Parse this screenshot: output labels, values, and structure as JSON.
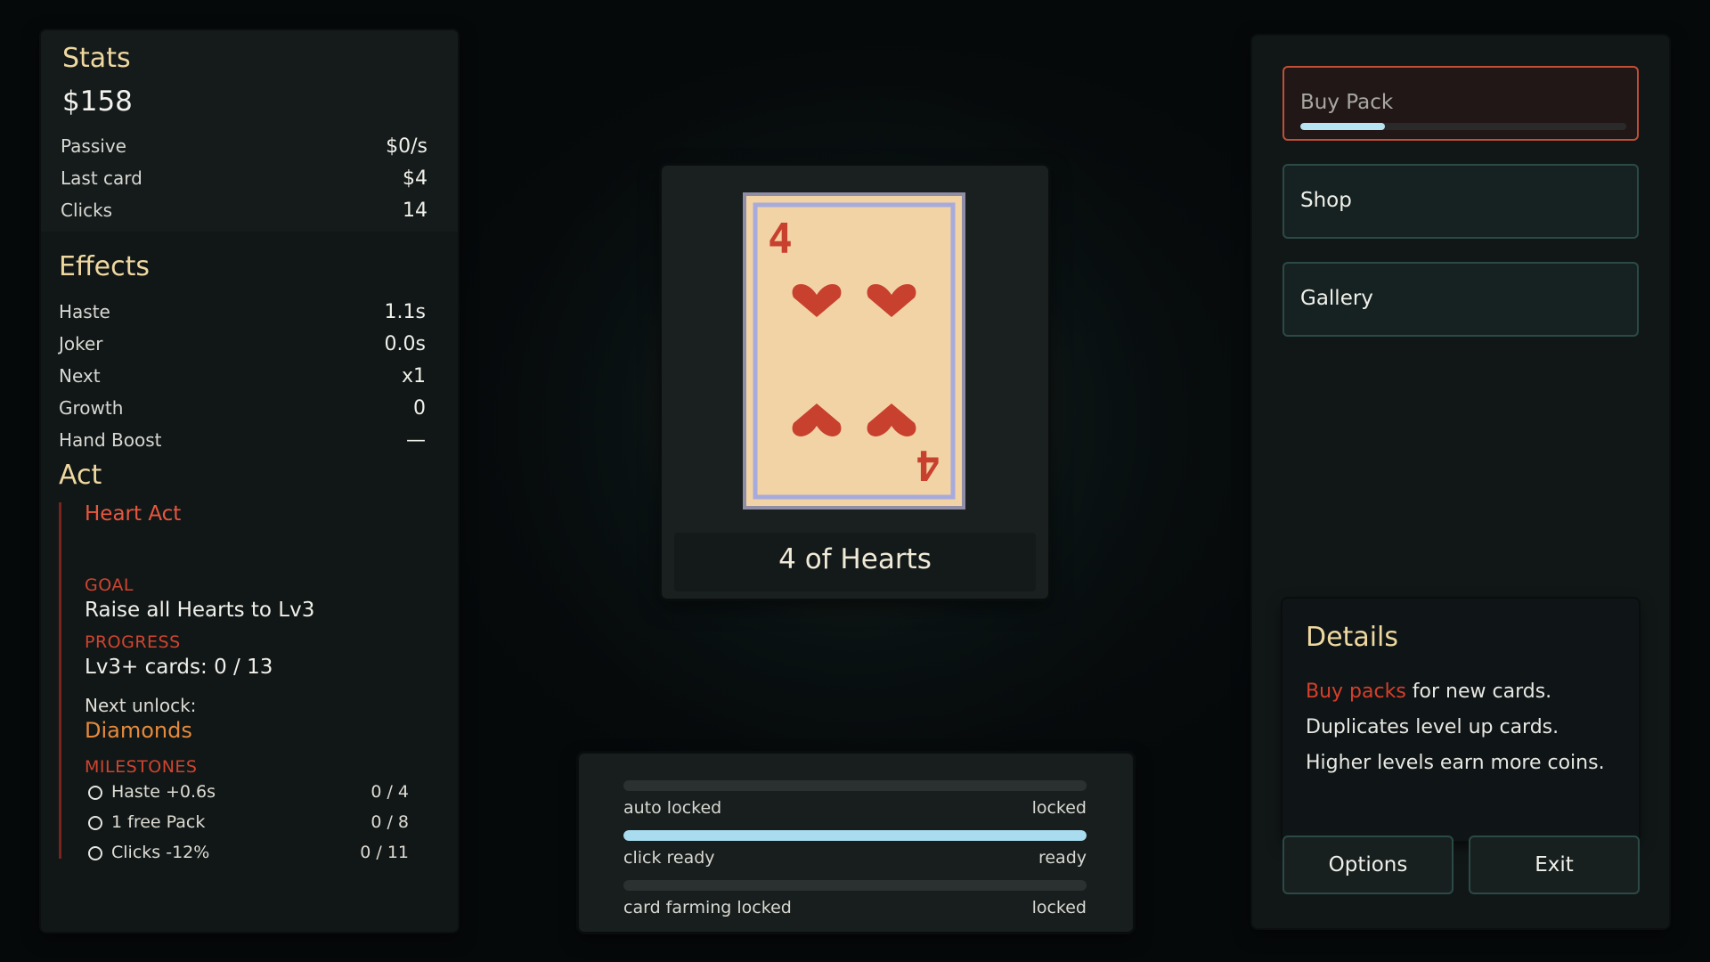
{
  "stats": {
    "title": "Stats",
    "money": "$158",
    "rows": [
      {
        "label": "Passive",
        "value": "$0/s"
      },
      {
        "label": "Last card",
        "value": "$4"
      },
      {
        "label": "Clicks",
        "value": "14"
      }
    ]
  },
  "effects": {
    "title": "Effects",
    "rows": [
      {
        "label": "Haste",
        "value": "1.1s"
      },
      {
        "label": "Joker",
        "value": "0.0s"
      },
      {
        "label": "Next",
        "value": "x1"
      },
      {
        "label": "Growth",
        "value": "0"
      },
      {
        "label": "Hand Boost",
        "value": "—"
      }
    ]
  },
  "act": {
    "title": "Act",
    "name": "Heart Act",
    "goal_label": "GOAL",
    "goal_text": "Raise all Hearts to Lv3",
    "progress_label": "PROGRESS",
    "progress_text": "Lv3+ cards: 0 / 13",
    "next_unlock_label": "Next unlock:",
    "next_unlock_value": "Diamonds",
    "milestones_label": "MILESTONES",
    "milestones": [
      {
        "label": "Haste +0.6s",
        "progress": "0 / 4"
      },
      {
        "label": "1 free Pack",
        "progress": "0 / 8"
      },
      {
        "label": "Clicks -12%",
        "progress": "0 / 11"
      }
    ]
  },
  "card": {
    "name": "4 of Hearts",
    "rank": "4",
    "suit": "hearts",
    "suit_color": "#c8402e",
    "face_color": "#f2d3a6",
    "border_color": "#9fa3d6"
  },
  "bars": [
    {
      "label": "auto locked",
      "status": "locked",
      "fill": 0
    },
    {
      "label": "click ready",
      "status": "ready",
      "fill": 1
    },
    {
      "label": "card farming locked",
      "status": "locked",
      "fill": 0
    }
  ],
  "menu": {
    "buy_pack": "Buy Pack",
    "buy_pack_progress": 0.26,
    "shop": "Shop",
    "gallery": "Gallery"
  },
  "details": {
    "title": "Details",
    "line1_highlight": "Buy packs",
    "line1_rest": "for new cards.",
    "line2": "Duplicates level up cards.",
    "line3": "Higher levels earn more coins."
  },
  "footer": {
    "options": "Options",
    "exit": "Exit"
  },
  "colors": {
    "accent_gold": "#efd8a0",
    "accent_red": "#d0442f",
    "bar_fill": "#a9dcef"
  }
}
